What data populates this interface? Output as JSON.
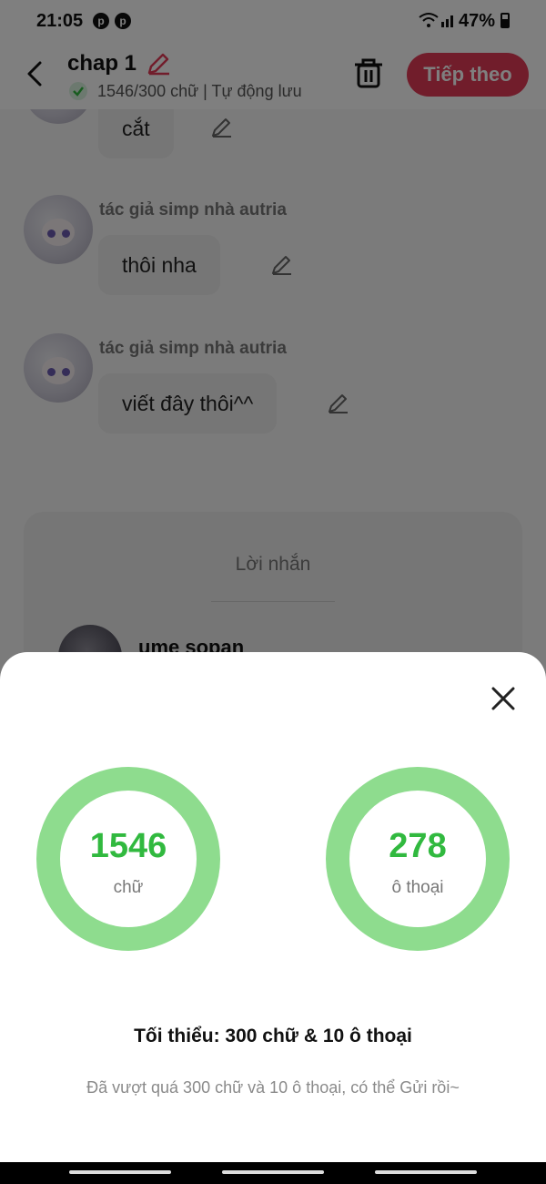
{
  "status_bar": {
    "time": "21:05",
    "battery": "47%",
    "app_icons": [
      "pinterest-icon",
      "pinterest-icon"
    ]
  },
  "header": {
    "title": "chap 1",
    "subtitle": "1546/300 chữ | Tự động lưu",
    "next_label": "Tiếp theo"
  },
  "chat": {
    "messages": [
      {
        "author": "",
        "text": "cắt"
      },
      {
        "author": "tác giả simp nhà autria",
        "text": "thôi nha"
      },
      {
        "author": "tác giả simp nhà autria",
        "text": "viết đây thôi^^"
      }
    ],
    "message_box": {
      "title": "Lời nhắn",
      "user": "ume sopan"
    }
  },
  "sheet": {
    "words": {
      "value": "1546",
      "label": "chữ"
    },
    "dialogs": {
      "value": "278",
      "label": "ô thoại"
    },
    "minimum": "Tối thiểu: 300 chữ & 10 ô thoại",
    "note": "Đã vượt quá 300 chữ và 10 ô thoại, có thể Gửi rồi~"
  },
  "colors": {
    "accent": "#e23a57",
    "ring": "#8edc8e",
    "value_green": "#31b93f"
  }
}
